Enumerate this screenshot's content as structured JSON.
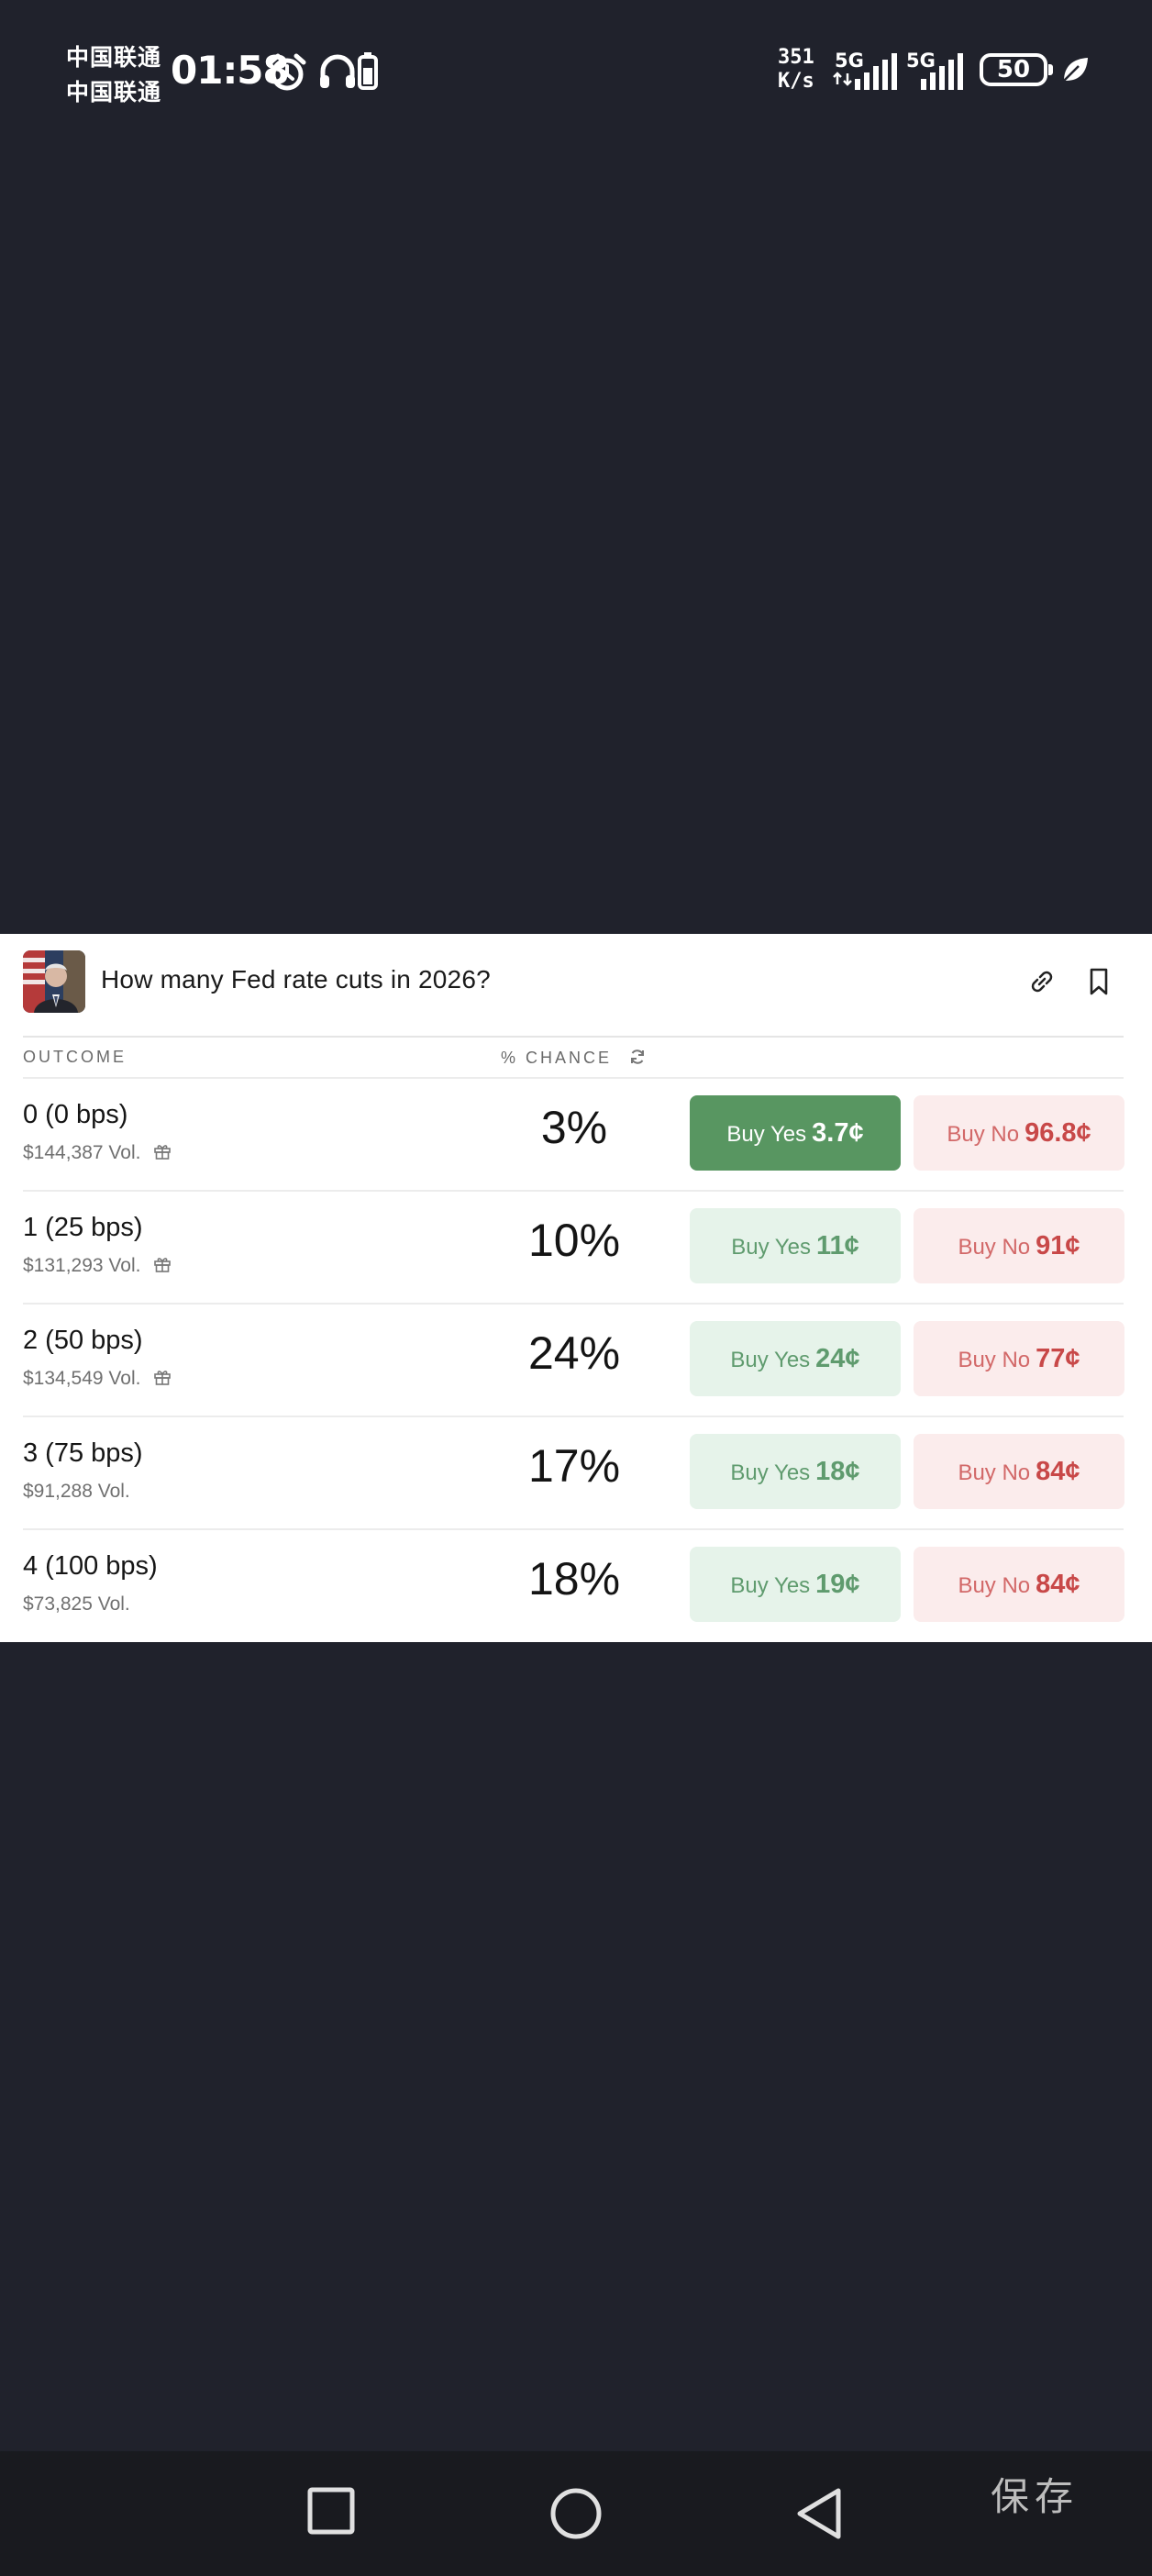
{
  "status_bar": {
    "carrier_1": "中国联通",
    "carrier_2": "中国联通",
    "time": "01:58",
    "net_speed_value": "351",
    "net_speed_unit": "K/s",
    "network_1": "5G",
    "network_2": "5G",
    "battery_level": "50",
    "icons": [
      "alarm-icon",
      "headphones-icon",
      "battery-small-icon",
      "signal-icon",
      "leaf-icon"
    ]
  },
  "market": {
    "title": "How many Fed rate cuts in 2026?",
    "columns": {
      "outcome": "OUTCOME",
      "chance": "% CHANCE"
    },
    "rows": [
      {
        "name": "0 (0 bps)",
        "volume": "$144,387 Vol.",
        "gift": true,
        "chance": "3%",
        "yes_label": "Buy Yes",
        "yes_price": "3.7¢",
        "no_label": "Buy No",
        "no_price": "96.8¢",
        "selected": true
      },
      {
        "name": "1 (25 bps)",
        "volume": "$131,293 Vol.",
        "gift": true,
        "chance": "10%",
        "yes_label": "Buy Yes",
        "yes_price": "11¢",
        "no_label": "Buy No",
        "no_price": "91¢",
        "selected": false
      },
      {
        "name": "2 (50 bps)",
        "volume": "$134,549 Vol.",
        "gift": true,
        "chance": "24%",
        "yes_label": "Buy Yes",
        "yes_price": "24¢",
        "no_label": "Buy No",
        "no_price": "77¢",
        "selected": false
      },
      {
        "name": "3 (75 bps)",
        "volume": "$91,288 Vol.",
        "gift": false,
        "chance": "17%",
        "yes_label": "Buy Yes",
        "yes_price": "18¢",
        "no_label": "Buy No",
        "no_price": "84¢",
        "selected": false
      },
      {
        "name": "4 (100 bps)",
        "volume": "$73,825 Vol.",
        "gift": false,
        "chance": "18%",
        "yes_label": "Buy Yes",
        "yes_price": "19¢",
        "no_label": "Buy No",
        "no_price": "84¢",
        "selected": false
      }
    ],
    "colors": {
      "yes_active": "#589661",
      "yes_bg": "#e6f3ea",
      "no_bg": "#fbecec",
      "no_text": "#c84848"
    }
  },
  "nav_bar": {
    "save_label": "保存",
    "buttons": [
      "recents-square-icon",
      "home-circle-icon",
      "back-triangle-icon"
    ]
  }
}
